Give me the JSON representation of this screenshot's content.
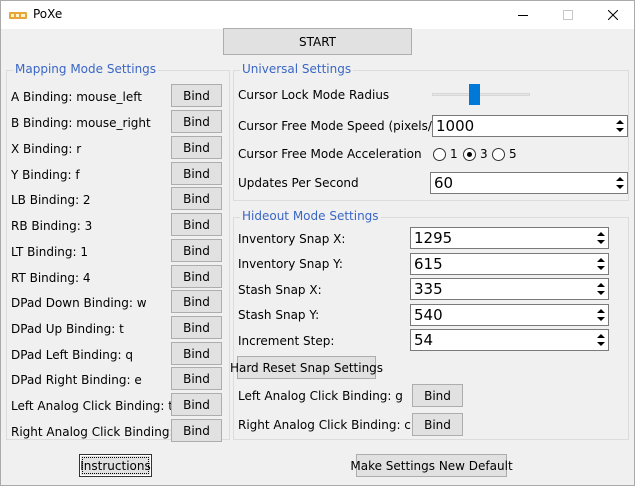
{
  "window": {
    "title": "PoXe"
  },
  "toolbar": {
    "start_label": "START"
  },
  "mapping": {
    "title": "Mapping Mode Settings",
    "bind_label": "Bind",
    "items": [
      {
        "label": "A Binding: mouse_left"
      },
      {
        "label": "B Binding: mouse_right"
      },
      {
        "label": "X Binding: r"
      },
      {
        "label": "Y Binding: f"
      },
      {
        "label": "LB Binding: 2"
      },
      {
        "label": "RB Binding: 3"
      },
      {
        "label": "LT Binding: 1"
      },
      {
        "label": "RT Binding: 4"
      },
      {
        "label": "DPad Down Binding: w"
      },
      {
        "label": "DPad Up Binding: t"
      },
      {
        "label": "DPad Left Binding: q"
      },
      {
        "label": "DPad Right Binding: e"
      },
      {
        "label": "Left Analog Click Binding: tab"
      },
      {
        "label": "Right Analog Click Binding: g"
      }
    ]
  },
  "universal": {
    "title": "Universal Settings",
    "lock_radius_label": "Cursor Lock Mode Radius",
    "lock_radius_fraction": 0.42,
    "free_speed_label": "Cursor Free Mode Speed (pixels/sec)",
    "free_speed_value": "1000",
    "accel_label": "Cursor Free Mode Acceleration",
    "accel_options": [
      "1",
      "3",
      "5"
    ],
    "accel_selected": "3",
    "updates_label": "Updates Per Second",
    "updates_value": "60"
  },
  "hideout": {
    "title": "Hideout Mode Settings",
    "inv_x_label": "Inventory Snap X:",
    "inv_x_value": "1295",
    "inv_y_label": "Inventory Snap Y:",
    "inv_y_value": "615",
    "stash_x_label": "Stash Snap X:",
    "stash_x_value": "335",
    "stash_y_label": "Stash Snap Y:",
    "stash_y_value": "540",
    "increment_label": "Increment Step:",
    "increment_value": "54",
    "hard_reset_label": "Hard Reset Snap Settings",
    "left_click_label": "Left Analog Click Binding: g",
    "right_click_label": "Right Analog Click Binding: c",
    "bind_label": "Bind"
  },
  "footer": {
    "instructions_label": "Instructions",
    "default_label": "Make Settings New Default"
  },
  "colors": {
    "accent": "#0078d7",
    "group_title": "#3a66c4",
    "bg": "#f0f0f0"
  }
}
